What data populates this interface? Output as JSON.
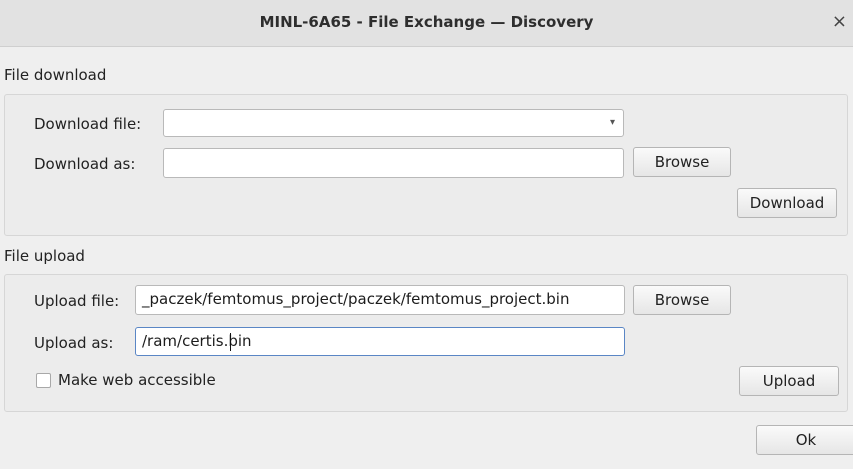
{
  "window": {
    "title": "MINL-6A65 - File Exchange — Discovery",
    "close_glyph": "×",
    "close_icon": "close-icon"
  },
  "download": {
    "section_label": "File download",
    "file_label": "Download file:",
    "file_value": "",
    "file_arrow": "▾",
    "as_label": "Download as:",
    "as_value": "",
    "browse_label": "Browse",
    "action_label": "Download"
  },
  "upload": {
    "section_label": "File upload",
    "file_label": "Upload file:",
    "file_value": "_paczek/femtomus_project/paczek/femtomus_project.bin",
    "browse_label": "Browse",
    "as_label": "Upload as:",
    "as_value": "/ram/certis.bin",
    "web_accessible_label": "Make web accessible",
    "web_accessible_checked": false,
    "action_label": "Upload"
  },
  "footer": {
    "ok_label": "Ok"
  }
}
